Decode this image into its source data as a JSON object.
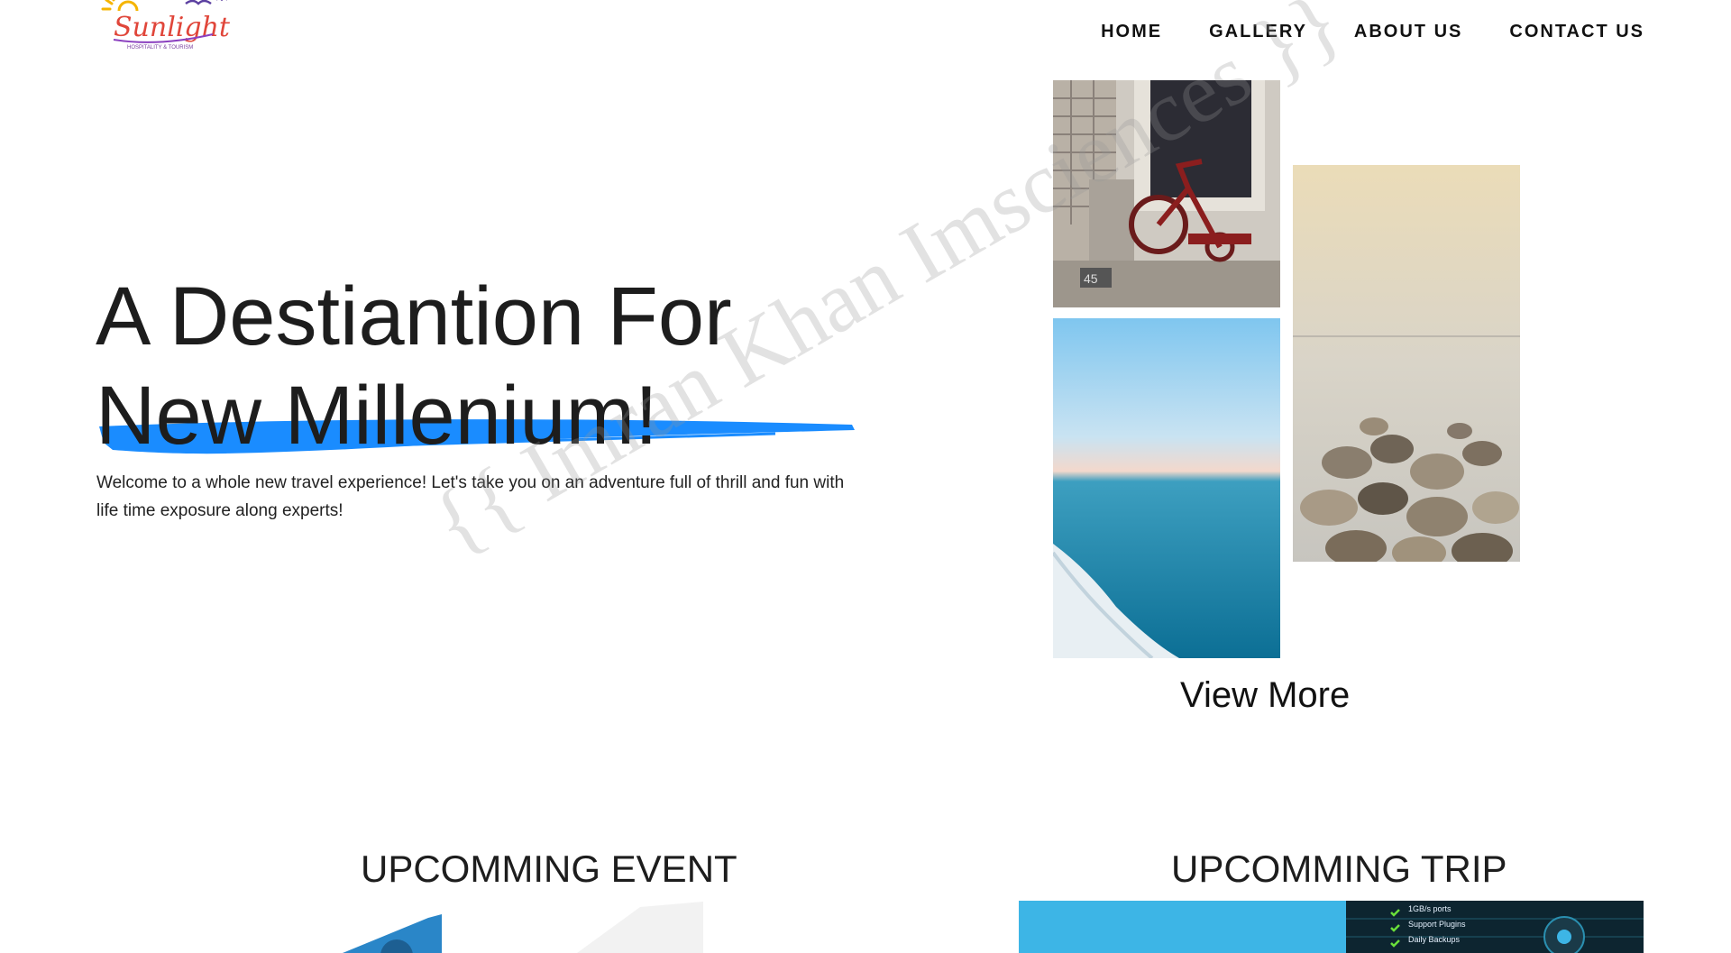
{
  "brand": {
    "logo_text": "Sunlight",
    "logo_subtext": "HOSPITALITY & TOURISM"
  },
  "nav": {
    "items": [
      "HOME",
      "GALLERY",
      "ABOUT US",
      "CONTACT US"
    ]
  },
  "hero": {
    "title_line1": "A Destiantion For",
    "title_line2": "New Millenium!",
    "description": "Welcome to a whole new travel experience! Let's take you on an adventure full of thrill and fun with life time exposure along experts!",
    "accent_color": "#1a8cff"
  },
  "gallery": {
    "images": [
      {
        "name": "tricycle-photo"
      },
      {
        "name": "ocean-photo"
      },
      {
        "name": "rocks-photo"
      }
    ],
    "view_more_label": "View More"
  },
  "watermark": {
    "text": "{{ Imran Khan Imsciences }}"
  },
  "sections": {
    "event_title": "UPCOMMING EVENT",
    "trip_title": "UPCOMMING TRIP",
    "trip_features": [
      "1GB/s ports",
      "Support Plugins",
      "Daily Backups"
    ]
  }
}
